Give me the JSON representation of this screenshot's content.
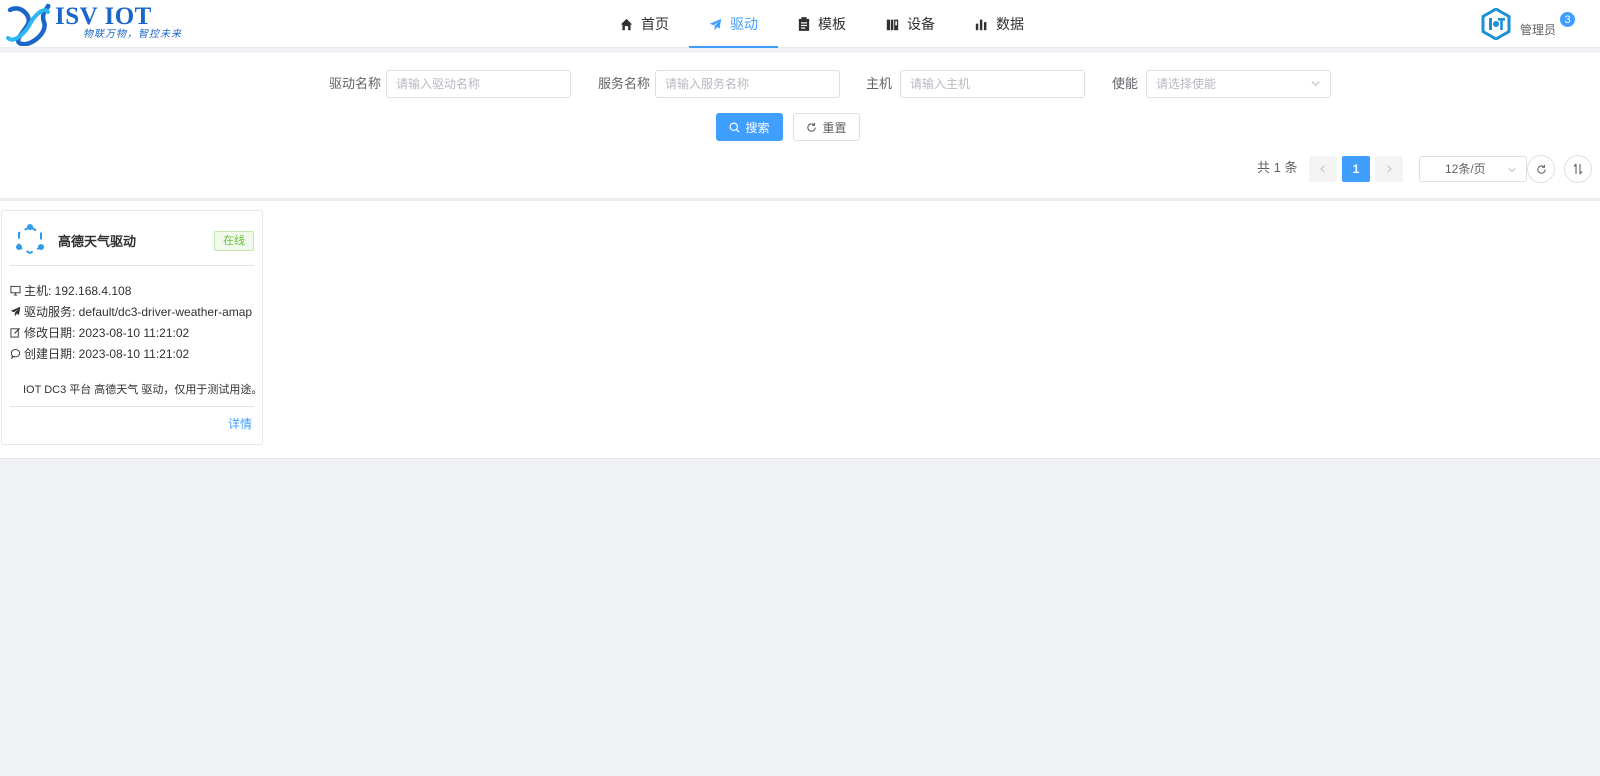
{
  "app": {
    "logo_text": "ISV IOT",
    "logo_slogan": "物联万物，智控未来"
  },
  "nav": {
    "items": [
      {
        "label": "首页",
        "icon": "home-icon"
      },
      {
        "label": "驱动",
        "icon": "send-icon",
        "active": true
      },
      {
        "label": "模板",
        "icon": "clipboard-icon"
      },
      {
        "label": "设备",
        "icon": "device-icon"
      },
      {
        "label": "数据",
        "icon": "bar-chart-icon"
      }
    ]
  },
  "user": {
    "name": "管理员",
    "badge": "3"
  },
  "search": {
    "driver_name_label": "驱动名称",
    "driver_name_placeholder": "请输入驱动名称",
    "service_name_label": "服务名称",
    "service_name_placeholder": "请输入服务名称",
    "host_label": "主机",
    "host_placeholder": "请输入主机",
    "enable_label": "使能",
    "enable_placeholder": "请选择使能",
    "search_button": "搜索",
    "reset_button": "重置"
  },
  "pagination": {
    "total": "共 1 条",
    "current_page": "1",
    "page_size": "12条/页"
  },
  "colors": {
    "primary": "#409eff",
    "online": "#67c23a"
  },
  "drivers": [
    {
      "name": "高德天气驱动",
      "status": "在线",
      "host": "主机: 192.168.4.108",
      "service": "驱动服务: default/dc3-driver-weather-amap",
      "modified": "修改日期: 2023-08-10 11:21:02",
      "created": "创建日期: 2023-08-10 11:21:02",
      "description": "IOT DC3 平台 高德天气 驱动，仅用于测试用途。",
      "detail_link": "详情"
    }
  ]
}
